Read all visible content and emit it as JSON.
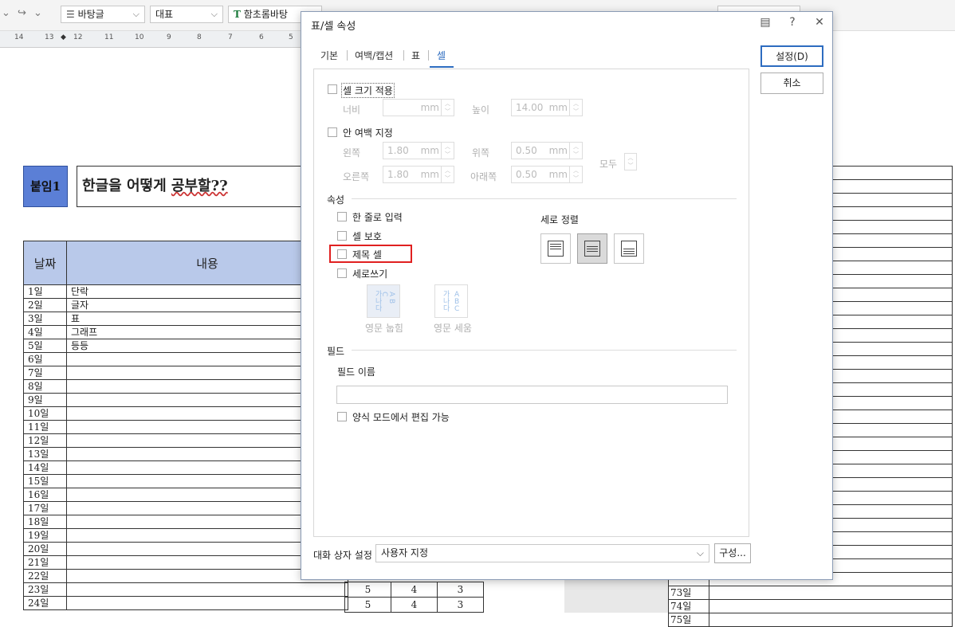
{
  "toolbar": {
    "style_name": "바탕글",
    "font_lang": "대표",
    "font_name": "함초롬바탕",
    "font_icon_glyph": "T"
  },
  "ruler": {
    "numbers": [
      "14",
      "13",
      "12",
      "11",
      "10",
      "9",
      "8",
      "7",
      "6",
      "5"
    ]
  },
  "document": {
    "badge": "붙임1",
    "title_plain": "한글을 어떻게 ",
    "title_underlined": "공부할??",
    "table_headers": {
      "date": "날짜",
      "content": "내용"
    },
    "rows": [
      {
        "date": "1일",
        "content": "단락"
      },
      {
        "date": "2일",
        "content": "글자"
      },
      {
        "date": "3일",
        "content": "표"
      },
      {
        "date": "4일",
        "content": "그래프"
      },
      {
        "date": "5일",
        "content": "등등"
      },
      {
        "date": "6일",
        "content": ""
      },
      {
        "date": "7일",
        "content": ""
      },
      {
        "date": "8일",
        "content": ""
      },
      {
        "date": "9일",
        "content": ""
      },
      {
        "date": "10일",
        "content": ""
      },
      {
        "date": "11일",
        "content": ""
      },
      {
        "date": "12일",
        "content": ""
      },
      {
        "date": "13일",
        "content": ""
      },
      {
        "date": "14일",
        "content": ""
      },
      {
        "date": "15일",
        "content": ""
      },
      {
        "date": "16일",
        "content": ""
      },
      {
        "date": "17일",
        "content": ""
      },
      {
        "date": "18일",
        "content": ""
      },
      {
        "date": "19일",
        "content": ""
      },
      {
        "date": "20일",
        "content": ""
      },
      {
        "date": "21일",
        "content": ""
      },
      {
        "date": "22일",
        "content": ""
      },
      {
        "date": "23일",
        "content": ""
      },
      {
        "date": "24일",
        "content": ""
      }
    ],
    "mid_rows": [
      [
        "5",
        "4",
        "3"
      ],
      [
        "5",
        "4",
        "3"
      ]
    ],
    "right_rows": [
      "",
      "",
      "",
      "",
      "",
      "",
      "",
      "",
      "",
      "",
      "",
      "",
      "",
      "",
      "",
      "",
      "",
      "",
      "",
      "",
      "",
      "",
      "",
      "",
      "",
      "",
      "",
      "",
      "",
      "",
      "",
      "73일",
      "74일",
      "75일"
    ]
  },
  "dialog": {
    "title": "표/셀 속성",
    "help_glyph": "?",
    "close_glyph": "✕",
    "comment_glyph": "▤",
    "tabs": [
      "기본",
      "여백/캡션",
      "표",
      "셀"
    ],
    "active_tab": "셀",
    "ok_button": "설정(D)",
    "cancel_button": "취소",
    "cell_size": {
      "label": "셀 크기 적용",
      "width_label": "너비",
      "width_value": "",
      "height_label": "높이",
      "height_value": "14.00",
      "unit": "mm"
    },
    "padding": {
      "label": "안 여백 지정",
      "left_label": "왼쪽",
      "left_value": "1.80",
      "right_label": "오른쪽",
      "right_value": "1.80",
      "top_label": "위쪽",
      "top_value": "0.50",
      "bottom_label": "아래쪽",
      "bottom_value": "0.50",
      "all_label": "모두",
      "unit": "mm"
    },
    "properties": {
      "section_label": "속성",
      "single_line": "한 줄로 입력",
      "protect": "셀 보호",
      "header_cell": "제목 셀",
      "vertical_writing": "세로쓰기",
      "vertical_align_label": "세로 정렬",
      "latin_lying": "영문 눕힘",
      "latin_upright": "영문 세움",
      "hangul_sample": [
        "가",
        "나",
        "다"
      ],
      "latin_sample": [
        "A",
        "B",
        "C"
      ]
    },
    "field": {
      "section_label": "필드",
      "name_label": "필드 이름",
      "name_value": "",
      "edit_in_form": "양식 모드에서 편집 가능"
    },
    "footer": {
      "preset_label": "대화 상자 설정",
      "preset_value": "사용자 지정",
      "config_button": "구성..."
    },
    "highlight_color": "#e02020",
    "accent_color": "#2d6cc0"
  }
}
